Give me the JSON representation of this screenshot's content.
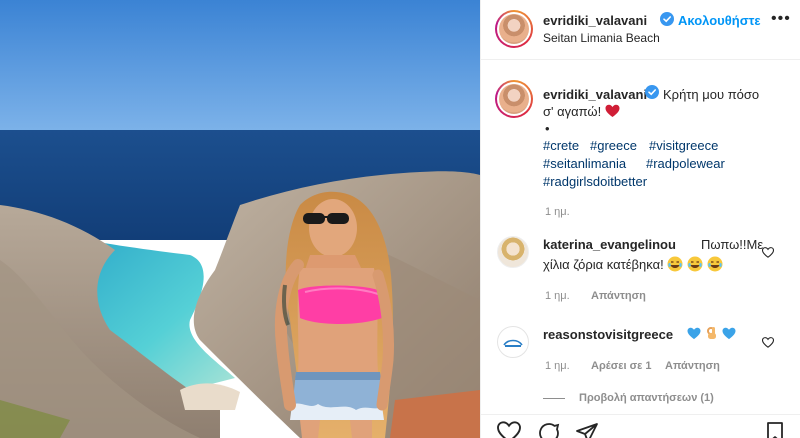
{
  "post": {
    "header": {
      "username": "evridiki_valavani",
      "follow_label": "Ακολουθήστε",
      "location": "Seitan Limania Beach",
      "more_label": "•••"
    },
    "caption": {
      "username": "evridiki_valavani",
      "text_line1": "Κρήτη μου πόσο",
      "text_line2": "σ' αγαπώ!",
      "dot": "•",
      "hashtags": [
        "#crete",
        "#greece",
        "#visitgreece",
        "#seitanlimania",
        "#radpolewear",
        "#radgirlsdoitbetter"
      ],
      "time": "1 ημ."
    },
    "comments": [
      {
        "username": "katerina_evangelinou",
        "text_line1": "Πωπω!!Με",
        "text_line2": "χίλια ζόρια κατέβηκα!",
        "emoji_count": 3,
        "time": "1 ημ.",
        "reply_label": "Απάντηση"
      },
      {
        "username": "reasonstovisitgreece",
        "time": "1 ημ.",
        "likes_label": "Αρέσει σε 1",
        "reply_label": "Απάντηση",
        "view_replies_label": "Προβολή απαντήσεων (1)"
      }
    ]
  },
  "colors": {
    "accent_blue": "#0095f6",
    "hashtag": "#00376b",
    "muted": "#8e8e8e",
    "verified": "#3897f0",
    "border": "#efefef"
  },
  "icons": [
    "verified-icon",
    "more-icon",
    "heart-icon",
    "comment-icon",
    "share-icon",
    "bookmark-icon"
  ]
}
